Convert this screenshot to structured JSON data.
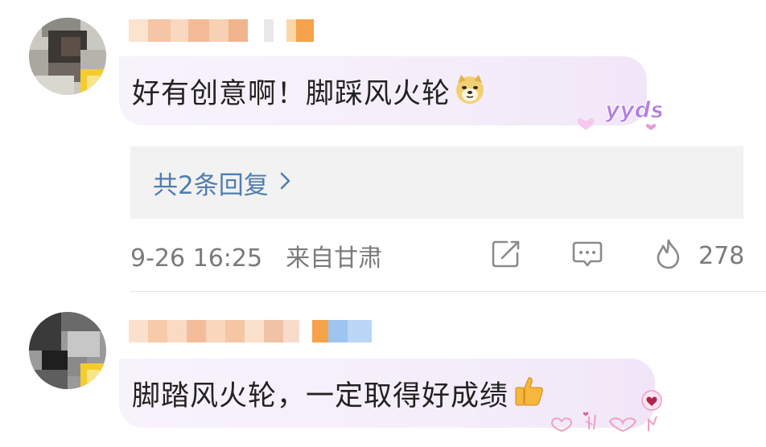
{
  "comments": [
    {
      "text": "好有创意啊！脚踩风火轮",
      "emoji": "doge-emoji",
      "sticker": "yyds",
      "replies_label": "共2条回复",
      "timestamp": "9-26 16:25",
      "location": "来自甘肃",
      "likes": "278"
    },
    {
      "text": "脚踏风火轮，一定取得好成绩",
      "emoji": "thumbs-up-emoji",
      "sticker_icons": [
        "hand-heart-icon",
        "finger-heart-icon",
        "heart-hands-icon",
        "love-gesture-icon"
      ]
    }
  ],
  "colors": {
    "reply_link": "#507daf",
    "meta_text": "#7a7a7a",
    "bubble_bg": "#f5eefa",
    "replies_bg": "#f2f2f2",
    "sticker_purple": "#b37ee6"
  }
}
